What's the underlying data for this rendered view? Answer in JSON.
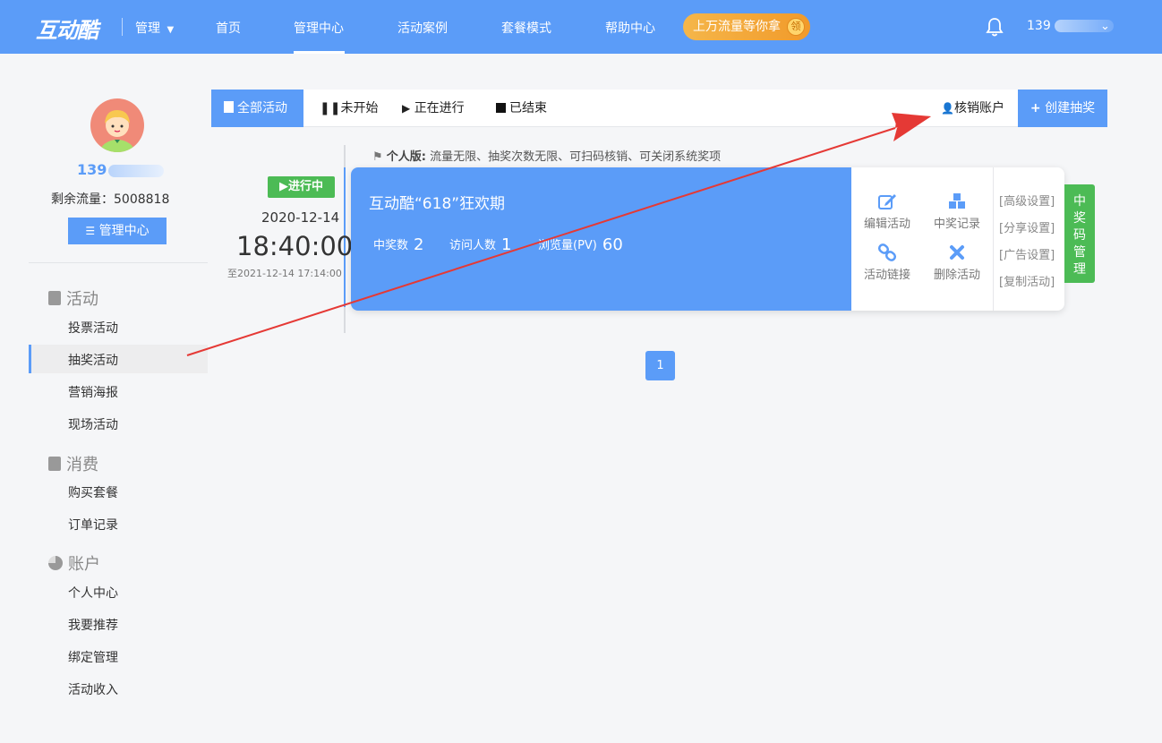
{
  "topbar": {
    "logo": "互动酷",
    "manage_label": "管理",
    "nav": [
      "首页",
      "管理中心",
      "活动案例",
      "套餐模式",
      "帮助中心"
    ],
    "active_nav": "管理中心",
    "promo": "上万流量等你拿",
    "promo_coin": "领",
    "user_prefix": "139"
  },
  "sidebar": {
    "phone_prefix": "139",
    "flow_label": "剩余流量：",
    "flow_value": "5008818",
    "center_button": "管理中心",
    "groups": [
      {
        "title": "活动",
        "items": [
          "投票活动",
          "抽奖活动",
          "营销海报",
          "现场活动"
        ]
      },
      {
        "title": "消费",
        "items": [
          "购买套餐",
          "订单记录"
        ]
      },
      {
        "title": "账户",
        "items": [
          "个人中心",
          "我要推荐",
          "绑定管理",
          "活动收入"
        ]
      }
    ],
    "active_item": "抽奖活动"
  },
  "tabs": {
    "all": "全部活动",
    "not_started": "未开始",
    "ongoing": "正在进行",
    "ended": "已结束",
    "verify": "核销账户",
    "create": "创建抽奖"
  },
  "notice": {
    "label": "个人版:",
    "text": "流量无限、抽奖次数无限、可扫码核销、可关闭系统奖项"
  },
  "activity": {
    "status": "进行中",
    "date": "2020-12-14",
    "time": "18:40:00",
    "until": "至2021-12-14 17:14:00",
    "title": "互动酷“618”狂欢期",
    "stats": [
      {
        "label": "中奖数",
        "value": "2"
      },
      {
        "label": "访问人数",
        "value": "1"
      },
      {
        "label": "浏览量(PV)",
        "value": "60"
      }
    ],
    "actions": {
      "edit": "编辑活动",
      "records": "中奖记录",
      "link": "活动链接",
      "delete": "删除活动"
    },
    "settings": [
      "[高级设置]",
      "[分享设置]",
      "[广告设置]",
      "[复制活动]"
    ],
    "prize_code": [
      "中",
      "奖",
      "码",
      "管",
      "理"
    ]
  },
  "pagination": {
    "current": "1"
  },
  "colors": {
    "primary": "#5b9cf8",
    "green": "#4cbb55",
    "promo": "#f19a2a",
    "annotation_arrow": "#e53935"
  }
}
